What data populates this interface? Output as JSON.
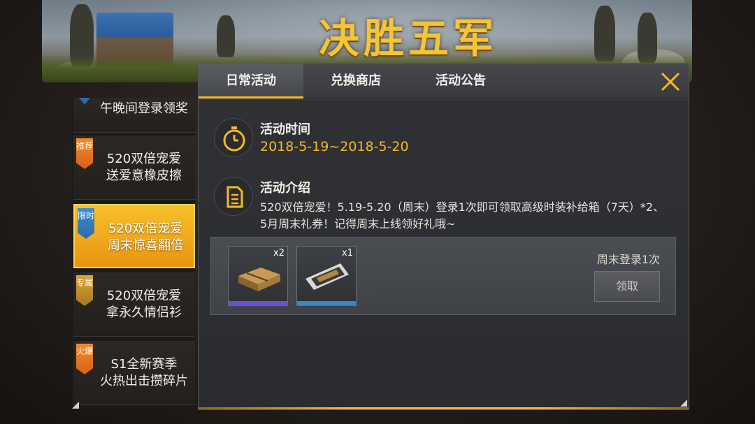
{
  "banner": {
    "title": "决胜五军"
  },
  "tabs": [
    {
      "label": "日常活动",
      "active": true
    },
    {
      "label": "兑换商店",
      "active": false
    },
    {
      "label": "活动公告",
      "active": false
    }
  ],
  "sidebar": {
    "items": [
      {
        "label": "午晚间登录领奖",
        "tag": "",
        "active": false
      },
      {
        "label": "520双倍宠爱\n送爱意橡皮擦",
        "tag": "推荐",
        "tag_color": "#e4762a",
        "active": false
      },
      {
        "label": "520双倍宠爱\n周末惊喜翻倍",
        "tag": "限时",
        "tag_color": "#3480c2",
        "active": true
      },
      {
        "label": "520双倍宠爱\n拿永久情侣衫",
        "tag": "专属",
        "tag_color": "#c7952f",
        "active": false
      },
      {
        "label": "S1全新赛季\n火热出击攒碎片",
        "tag": "火爆",
        "tag_color": "#e4762a",
        "active": false
      }
    ]
  },
  "activity": {
    "time_title": "活动时间",
    "time_value": "2018-5-19~2018-5-20",
    "time_icon": "stopwatch-icon",
    "intro_title": "活动介绍",
    "intro_icon": "document-icon",
    "intro_text": "520双倍宠爱！5.19-5.20（周末）登录1次即可领取高级时装补给箱（7天）*2、5月周末礼券！记得周末上线领好礼哦~"
  },
  "reward": {
    "items": [
      {
        "name": "supply-crate",
        "qty": "x2",
        "rarity_color": "#6b4fcf"
      },
      {
        "name": "weekend-voucher",
        "qty": "x1",
        "rarity_color": "#3a86c8"
      }
    ],
    "condition": "周末登录1次",
    "claim_label": "领取"
  },
  "colors": {
    "accent": "#f4b82a",
    "panel": "#2f3135"
  }
}
